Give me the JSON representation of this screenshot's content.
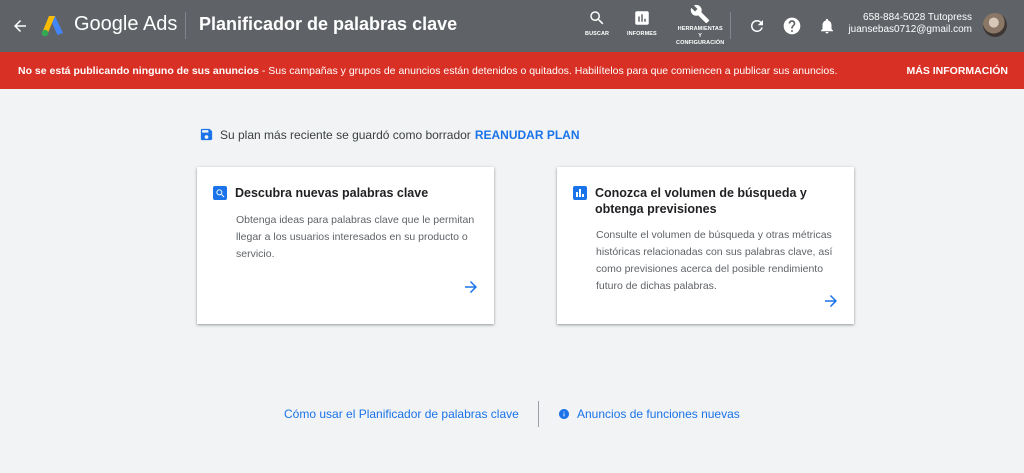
{
  "header": {
    "brand": "Google Ads",
    "page_title": "Planificador de palabras clave",
    "nav": [
      {
        "label": "BUSCAR",
        "icon": "search-icon"
      },
      {
        "label": "INFORMES",
        "icon": "reports-icon"
      },
      {
        "label_lines": [
          "HERRAMIENTAS",
          "Y",
          "CONFIGURACIÓN"
        ],
        "icon": "wrench-icon"
      }
    ],
    "account_name": "658-884-5028 Tutopress",
    "account_email": "juansebas0712@gmail.com"
  },
  "alert": {
    "bold": "No se está publicando ninguno de sus anuncios",
    "text": " - Sus campañas y grupos de anuncios están detenidos o quitados. Habilítelos para que comiencen a publicar sus anuncios.",
    "action": "MÁS INFORMACIÓN"
  },
  "draft": {
    "text": "Su plan más reciente se guardó como borrador",
    "link": "REANUDAR PLAN"
  },
  "cards": [
    {
      "title": "Descubra nuevas palabras clave",
      "description": "Obtenga ideas para palabras clave que le permitan llegar a los usuarios interesados en su producto o servicio.",
      "icon": "search-icon"
    },
    {
      "title": "Conozca el volumen de búsqueda y obtenga previsiones",
      "description": "Consulte el volumen de búsqueda y otras métricas históricas relacionadas con sus palabras clave, así como previsiones acerca del posible rendimiento futuro de dichas palabras.",
      "icon": "bar-chart-icon"
    }
  ],
  "footer": {
    "link1": "Cómo usar el Planificador de palabras clave",
    "link2": "Anuncios de funciones nuevas"
  },
  "colors": {
    "topbar": "#5f6368",
    "alert": "#d93025",
    "accent": "#1a73e8",
    "background": "#f1f3f4"
  }
}
